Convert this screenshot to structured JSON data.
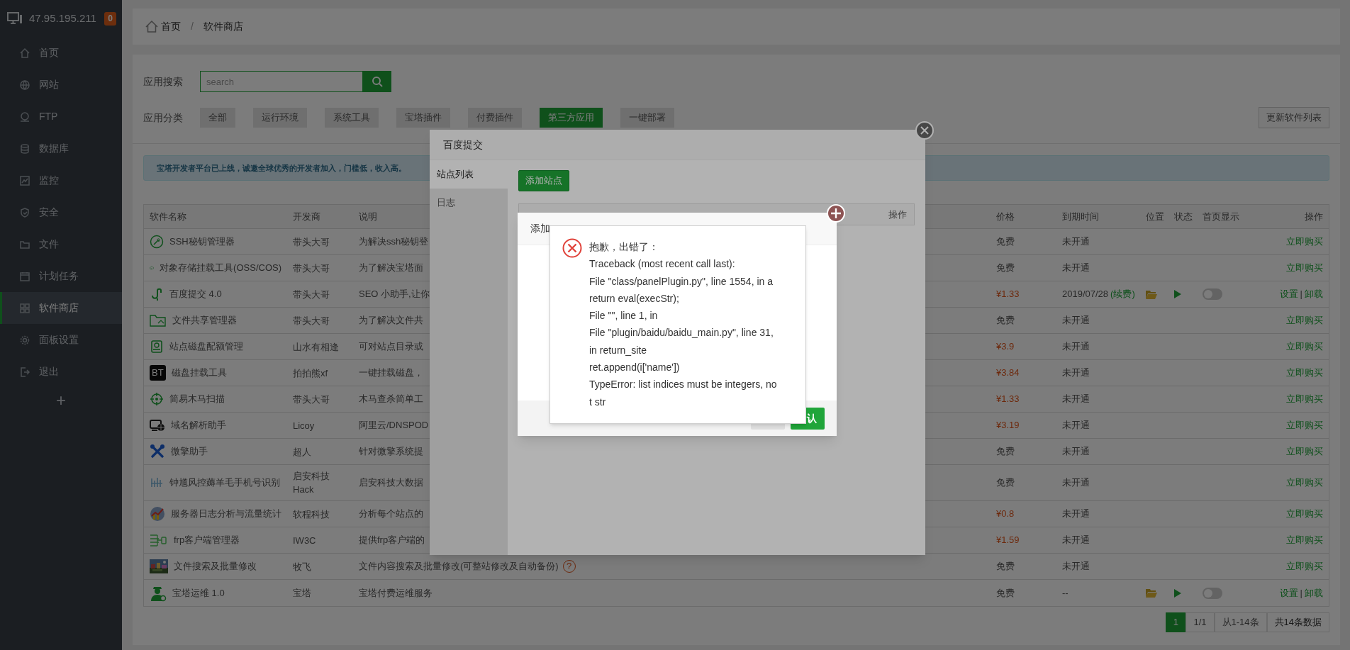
{
  "sidebar": {
    "server_ip": "47.95.195.211",
    "alert_count": "0",
    "items": [
      {
        "label": "首页",
        "selected": false
      },
      {
        "label": "网站",
        "selected": false
      },
      {
        "label": "FTP",
        "selected": false
      },
      {
        "label": "数据库",
        "selected": false
      },
      {
        "label": "监控",
        "selected": false
      },
      {
        "label": "安全",
        "selected": false
      },
      {
        "label": "文件",
        "selected": false
      },
      {
        "label": "计划任务",
        "selected": false
      },
      {
        "label": "软件商店",
        "selected": true
      },
      {
        "label": "面板设置",
        "selected": false
      },
      {
        "label": "退出",
        "selected": false
      }
    ],
    "add_label": "+"
  },
  "breadcrumb": {
    "items": [
      "首页",
      "软件商店"
    ],
    "separator": "/"
  },
  "search": {
    "label": "应用搜索",
    "placeholder": "search"
  },
  "categories": {
    "label": "应用分类",
    "items": [
      {
        "label": "全部",
        "selected": false
      },
      {
        "label": "运行环境",
        "selected": false
      },
      {
        "label": "系统工具",
        "selected": false
      },
      {
        "label": "宝塔插件",
        "selected": false
      },
      {
        "label": "付费插件",
        "selected": false
      },
      {
        "label": "第三方应用",
        "selected": true
      },
      {
        "label": "一键部署",
        "selected": false
      }
    ],
    "refresh_button": "更新软件列表"
  },
  "notice": "宝塔开发者平台已上线，诚邀全球优秀的开发者加入，门槛低，收入高。",
  "table": {
    "columns": [
      "软件名称",
      "开发商",
      "说明",
      "价格",
      "到期时间",
      "位置",
      "状态",
      "首页显示",
      "操作"
    ],
    "rows": [
      {
        "name": "SSH秘钥管理器",
        "developer": "带头大哥",
        "description": "为解决ssh秘钥登",
        "price": "免费",
        "paid": false,
        "expiry": "未开通",
        "installed": false,
        "actions": [
          {
            "label": "立即购买",
            "kind": "link"
          }
        ]
      },
      {
        "name": "对象存储挂载工具(OSS/COS)",
        "developer": "带头大哥",
        "description": "为了解决宝塔面",
        "price": "免费",
        "paid": false,
        "expiry": "未开通",
        "installed": false,
        "actions": [
          {
            "label": "立即购买",
            "kind": "link"
          }
        ]
      },
      {
        "name": "百度提交 4.0",
        "developer": "带头大哥",
        "description": "SEO 小助手,让你",
        "price": "¥1.33",
        "paid": true,
        "expiry": "2019/07/28",
        "renew": "(续费)",
        "installed": true,
        "home_display": false,
        "actions": [
          {
            "label": "设置",
            "kind": "link"
          },
          {
            "label": "|",
            "kind": "separator"
          },
          {
            "label": "卸载",
            "kind": "link"
          }
        ]
      },
      {
        "name": "文件共享管理器",
        "developer": "带头大哥",
        "description": "为了解决文件共",
        "price": "免费",
        "paid": false,
        "expiry": "未开通",
        "installed": false,
        "actions": [
          {
            "label": "立即购买",
            "kind": "link"
          }
        ]
      },
      {
        "name": "站点磁盘配额管理",
        "developer": "山水有相逢",
        "description": "可对站点目录或",
        "price": "¥3.9",
        "paid": true,
        "expiry": "未开通",
        "installed": false,
        "actions": [
          {
            "label": "立即购买",
            "kind": "link"
          }
        ]
      },
      {
        "name": "磁盘挂载工具",
        "badge": "BT",
        "developer": "拍拍熊xf",
        "description": "一键挂载磁盘，",
        "price": "¥3.84",
        "paid": true,
        "expiry": "未开通",
        "installed": false,
        "actions": [
          {
            "label": "立即购买",
            "kind": "link"
          }
        ]
      },
      {
        "name": "简易木马扫描",
        "developer": "带头大哥",
        "description": "木马查杀简单工",
        "price": "¥1.33",
        "paid": true,
        "expiry": "未开通",
        "installed": false,
        "actions": [
          {
            "label": "立即购买",
            "kind": "link"
          }
        ]
      },
      {
        "name": "域名解析助手",
        "developer": "Licoy",
        "description": "阿里云/DNSPOD",
        "price": "¥3.19",
        "paid": true,
        "expiry": "未开通",
        "installed": false,
        "actions": [
          {
            "label": "立即购买",
            "kind": "link"
          }
        ]
      },
      {
        "name": "微擎助手",
        "developer": "超人",
        "description": "针对微擎系统提",
        "price": "免费",
        "paid": false,
        "expiry": "未开通",
        "installed": false,
        "actions": [
          {
            "label": "立即购买",
            "kind": "link"
          }
        ]
      },
      {
        "name": "钟馗风控薅羊毛手机号识别",
        "developer": "启安科技 Hack",
        "description": "启安科技大数据",
        "price": "免费",
        "paid": false,
        "expiry": "未开通",
        "installed": false,
        "actions": [
          {
            "label": "立即购买",
            "kind": "link"
          }
        ]
      },
      {
        "name": "服务器日志分析与流量统计",
        "developer": "软程科技",
        "description": "分析每个站点的",
        "price": "¥0.8",
        "paid": true,
        "expiry": "未开通",
        "installed": false,
        "actions": [
          {
            "label": "立即购买",
            "kind": "link"
          }
        ]
      },
      {
        "name": "frp客户端管理器",
        "developer": "IW3C",
        "description": "提供frp客户端的",
        "price": "¥1.59",
        "paid": true,
        "expiry": "未开通",
        "installed": false,
        "actions": [
          {
            "label": "立即购买",
            "kind": "link"
          }
        ]
      },
      {
        "name": "文件搜索及批量修改",
        "developer": "牧飞",
        "description": "文件内容搜索及批量修改(可整站修改及自动备份)",
        "help": "?",
        "price": "免费",
        "paid": false,
        "expiry": "未开通",
        "installed": false,
        "actions": [
          {
            "label": "立即购买",
            "kind": "link"
          }
        ]
      },
      {
        "name": "宝塔运维 1.0",
        "developer": "宝塔",
        "description": "宝塔付费运维服务",
        "price": "免费",
        "paid": false,
        "expiry": "--",
        "installed": true,
        "home_display": false,
        "actions": [
          {
            "label": "设置",
            "kind": "link"
          },
          {
            "label": "|",
            "kind": "separator"
          },
          {
            "label": "卸载",
            "kind": "link"
          }
        ]
      }
    ]
  },
  "pagination": {
    "current": "1",
    "pages": "1/1",
    "range": "从1-14条",
    "total": "共14条数据"
  },
  "plugin_dialog": {
    "title": "百度提交",
    "nav": [
      {
        "label": "站点列表",
        "selected": true
      },
      {
        "label": "日志",
        "selected": false
      }
    ],
    "add_button": "添加站点",
    "action_column": "操作"
  },
  "add_site_dialog": {
    "title": "添加",
    "confirm_visible_text": "认"
  },
  "error_message": {
    "lines": [
      "抱歉，出错了：",
      "Traceback (most recent call last):",
      "File \"class/panelPlugin.py\", line 1554, in a",
      "return eval(execStr);",
      "File \"\", line 1, in",
      "File \"plugin/baidu/baidu_main.py\", line 31,",
      "in return_site",
      "ret.append(i['name'])",
      "TypeError: list indices must be integers, no",
      "t str"
    ]
  }
}
